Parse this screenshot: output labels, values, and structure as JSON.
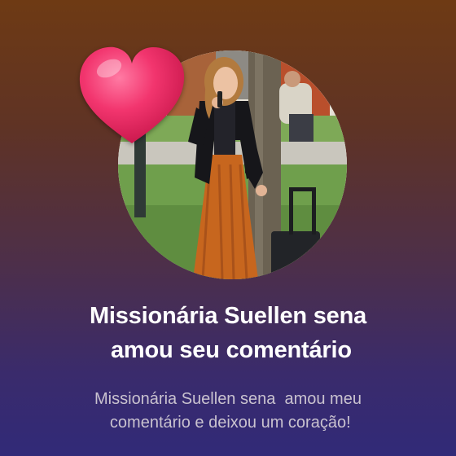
{
  "notification": {
    "avatar_icon": "profile-photo",
    "badge_icon": "heart-icon",
    "title_lines": [
      "Missionária Suellen sena",
      " amou seu comentário"
    ],
    "subtitle_lines": [
      "Missionária Suellen sena  amou meu",
      " comentário e deixou um coração!"
    ]
  },
  "colors": {
    "heart": "#f2356e",
    "title": "#ffffff",
    "subtitle": "#c9c2cf"
  }
}
